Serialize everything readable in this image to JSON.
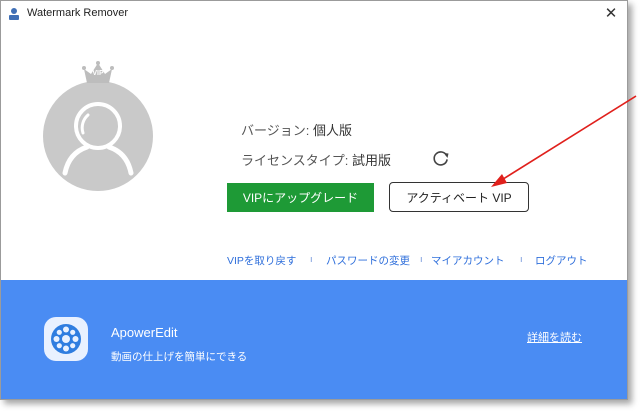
{
  "window": {
    "title": "Watermark Remover",
    "close_glyph": "✕"
  },
  "profile": {
    "crown_badge": "VIP"
  },
  "account": {
    "version_label": "バージョン: ",
    "version_value": "個人版",
    "license_label": "ライセンスタイプ: ",
    "license_value": "試用版"
  },
  "buttons": {
    "upgrade": "VIPにアップグレード",
    "activate": "アクティベート VIP"
  },
  "links": {
    "restore_vip": "VIPを取り戻す",
    "change_password": "パスワードの変更",
    "my_account": "マイアカウント",
    "logout": "ログアウト",
    "separator": "ı"
  },
  "promo": {
    "app_name": "ApowerEdit",
    "tagline": "動画の仕上げを簡単にできる",
    "read_more": "詳細を読む"
  },
  "colors": {
    "upgrade_green": "#1e9a36",
    "promo_blue": "#4a8cf3",
    "link_blue": "#2f6fdb",
    "avatar_gray": "#c9c9c9",
    "annotation_red": "#e0201c"
  }
}
